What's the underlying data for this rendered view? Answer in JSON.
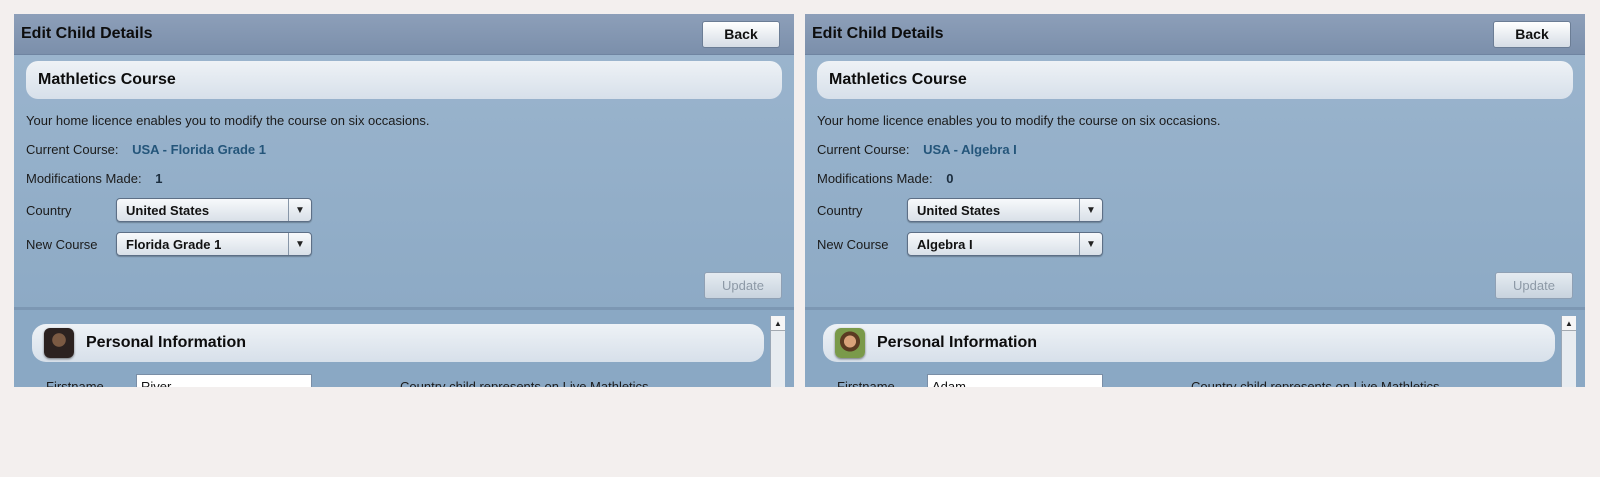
{
  "panels": [
    {
      "title": "Edit Child Details",
      "back_label": "Back",
      "course": {
        "header": "Mathletics Course",
        "licence_text": "Your home licence enables you to modify the course on six occasions.",
        "current_course_label": "Current Course:",
        "current_course_value": "USA - Florida Grade 1",
        "modifications_label": "Modifications Made:",
        "modifications_value": "1",
        "country_label": "Country",
        "country_value": "United States",
        "new_course_label": "New Course",
        "new_course_value": "Florida Grade 1",
        "update_label": "Update"
      },
      "personal": {
        "header": "Personal Information",
        "firstname_label": "Firstname",
        "firstname_value": "River",
        "help_text": "Country child represents on Live Mathletics."
      }
    },
    {
      "title": "Edit Child Details",
      "back_label": "Back",
      "course": {
        "header": "Mathletics Course",
        "licence_text": "Your home licence enables you to modify the course on six occasions.",
        "current_course_label": "Current Course:",
        "current_course_value": "USA - Algebra I",
        "modifications_label": "Modifications Made:",
        "modifications_value": "0",
        "country_label": "Country",
        "country_value": "United States",
        "new_course_label": "New Course",
        "new_course_value": "Algebra I",
        "update_label": "Update"
      },
      "personal": {
        "header": "Personal Information",
        "firstname_label": "Firstname",
        "firstname_value": "Adam",
        "help_text": "Country child represents on Live Mathletics."
      }
    }
  ],
  "icons": {
    "dropdown": "chevron-down-icon",
    "scroll_up": "scroll-up-arrow-icon",
    "avatar": "avatar-icon"
  },
  "colors": {
    "panel_bg": "#8aa8c4",
    "titlebar": "#7b8fab",
    "value_text": "#24557a",
    "page_bg": "#f3efee"
  }
}
